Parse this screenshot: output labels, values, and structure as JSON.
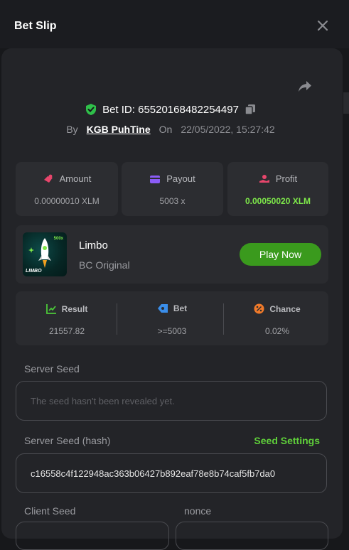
{
  "header": {
    "title": "Bet Slip"
  },
  "bet": {
    "id_text": "Bet ID: 65520168482254497",
    "by_label": "By",
    "user": "KGB PuhTine",
    "on_label": "On",
    "date": "22/05/2022, 15:27:42"
  },
  "stats": {
    "amount": {
      "label": "Amount",
      "value": "0.00000010 XLM"
    },
    "payout": {
      "label": "Payout",
      "value": "5003 x"
    },
    "profit": {
      "label": "Profit",
      "value": "0.00050020 XLM"
    }
  },
  "game": {
    "name": "Limbo",
    "subtitle": "BC Original",
    "thumb_label": "LIMBO",
    "thumb_badge": "500x",
    "play_label": "Play Now"
  },
  "result": {
    "result_label": "Result",
    "result_value": "21557.82",
    "bet_label": "Bet",
    "bet_value": ">=5003",
    "chance_label": "Chance",
    "chance_value": "0.02%"
  },
  "seeds": {
    "server_seed_label": "Server Seed",
    "server_seed_placeholder": "The seed hasn't been revealed yet.",
    "server_seed_hash_label": "Server Seed (hash)",
    "seed_settings_label": "Seed Settings",
    "server_seed_hash_value": "c16558c4f122948ac363b06427b892eaf78e8b74caf5fb7da0",
    "client_seed_label": "Client Seed",
    "nonce_label": "nonce"
  },
  "colors": {
    "accent_green": "#3a9a1d",
    "profit_green": "#7ee84a",
    "shield_green": "#2fc04a"
  }
}
